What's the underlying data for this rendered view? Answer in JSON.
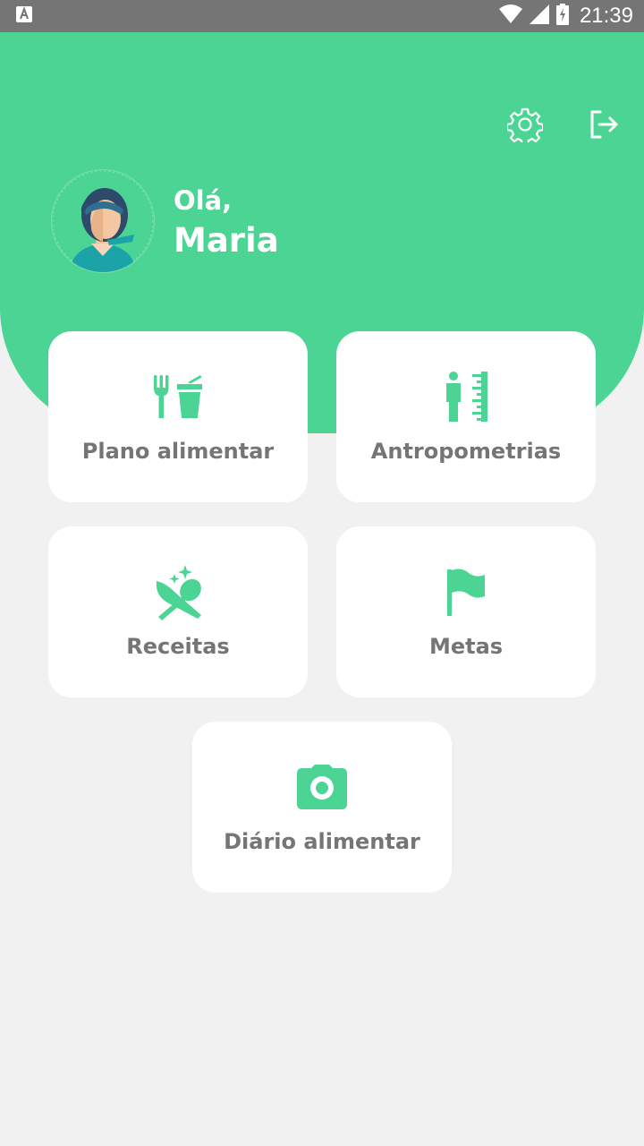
{
  "status_bar": {
    "time": "21:39"
  },
  "header": {
    "greeting": "Olá,",
    "user_name": "Maria"
  },
  "colors": {
    "accent": "#4cd494",
    "card_text": "#757575",
    "background": "#f1f1f1"
  },
  "menu": [
    {
      "label": "Plano alimentar",
      "icon": "fork-and-drink-icon"
    },
    {
      "label": "Antropometrias",
      "icon": "person-ruler-icon"
    },
    {
      "label": "Receitas",
      "icon": "utensils-sparkle-icon"
    },
    {
      "label": "Metas",
      "icon": "flag-icon"
    },
    {
      "label": "Diário alimentar",
      "icon": "camera-icon"
    }
  ]
}
